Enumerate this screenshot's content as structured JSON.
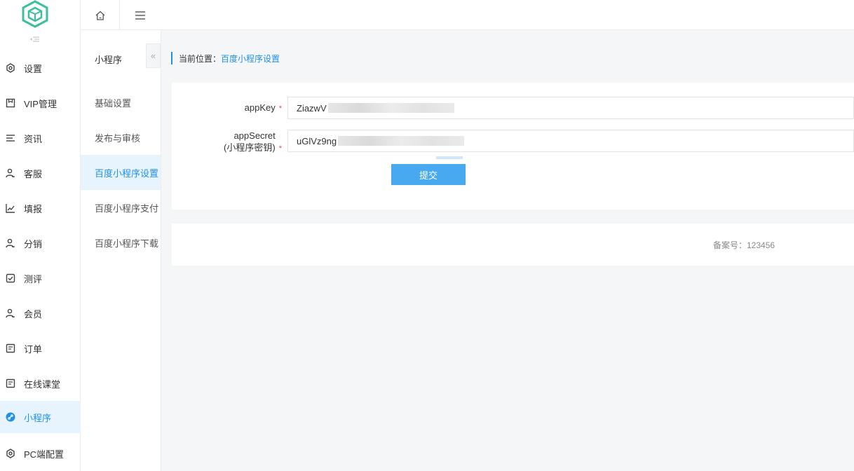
{
  "sidebar": {
    "items": [
      {
        "label": "设置",
        "icon": "gear-icon"
      },
      {
        "label": "VIP管理",
        "icon": "bookmark-icon"
      },
      {
        "label": "资讯",
        "icon": "list-icon"
      },
      {
        "label": "客服",
        "icon": "user-check-icon"
      },
      {
        "label": "填报",
        "icon": "chart-icon"
      },
      {
        "label": "分销",
        "icon": "user-check-icon"
      },
      {
        "label": "测评",
        "icon": "checkbox-icon"
      },
      {
        "label": "会员",
        "icon": "user-check-icon"
      },
      {
        "label": "订单",
        "icon": "document-icon"
      },
      {
        "label": "在线课堂",
        "icon": "document-icon"
      },
      {
        "label": "小程序",
        "icon": "link-icon",
        "active": true
      },
      {
        "label": "PC端配置",
        "icon": "gear-icon"
      }
    ]
  },
  "subnav": {
    "title": "小程序",
    "collapse_glyph": "«",
    "items": [
      {
        "label": "基础设置"
      },
      {
        "label": "发布与审核"
      },
      {
        "label": "百度小程序设置",
        "active": true
      },
      {
        "label": "百度小程序支付"
      },
      {
        "label": "百度小程序下载"
      }
    ]
  },
  "breadcrumb": {
    "prefix": "当前位置：",
    "current": "百度小程序设置"
  },
  "form": {
    "app_key_label": "appKey",
    "app_key_value": "ZiazwV",
    "app_secret_label": "appSecret",
    "app_secret_sublabel": "(小程序密钥)",
    "app_secret_value": "uGlVz9ng",
    "required_mark": "*",
    "submit_label": "提交"
  },
  "footer": {
    "icp_text": "备案号：123456"
  },
  "colors": {
    "accent": "#1e90e6",
    "button": "#49a9f0",
    "active_bg": "#e8f4fd",
    "required": "#e54d42"
  }
}
